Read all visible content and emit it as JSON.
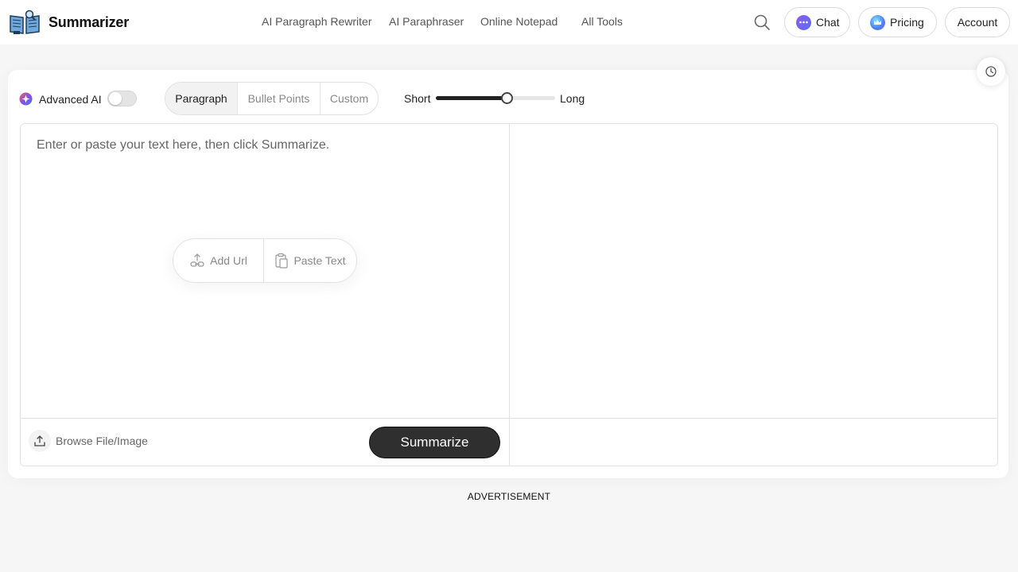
{
  "header": {
    "brand": "Summarizer",
    "nav": [
      "AI Paragraph Rewriter",
      "AI Paraphraser",
      "Online Notepad",
      "All Tools"
    ],
    "chat_label": "Chat",
    "pricing_label": "Pricing",
    "account_label": "Account"
  },
  "toolbar": {
    "advanced_ai_label": "Advanced AI",
    "advanced_ai_enabled": false,
    "modes": [
      "Paragraph",
      "Bullet Points",
      "Custom"
    ],
    "active_mode": "Paragraph",
    "length_short_label": "Short",
    "length_long_label": "Long",
    "length_value": 0.59
  },
  "editor": {
    "input_placeholder": "Enter or paste your text here, then click Summarize.",
    "input_value": "",
    "add_url_label": "Add Url",
    "paste_text_label": "Paste Text",
    "browse_label": "Browse File/Image",
    "summarize_label": "Summarize",
    "output_value": ""
  },
  "advertisement_label": "ADVERTISEMENT",
  "icons": {
    "logo": "book-reading-icon",
    "search": "search-icon",
    "chat": "chat-bubble-icon",
    "pricing": "crown-icon",
    "history": "clock-icon",
    "advanced_ai": "ai-sparkle-icon",
    "add_url": "link-upload-icon",
    "paste": "clipboard-icon",
    "browse": "upload-icon"
  },
  "colors": {
    "accent_dark": "#2f2f2f",
    "chat_icon": "#7b5cf5",
    "pricing_icon": "#4a9cf5"
  }
}
